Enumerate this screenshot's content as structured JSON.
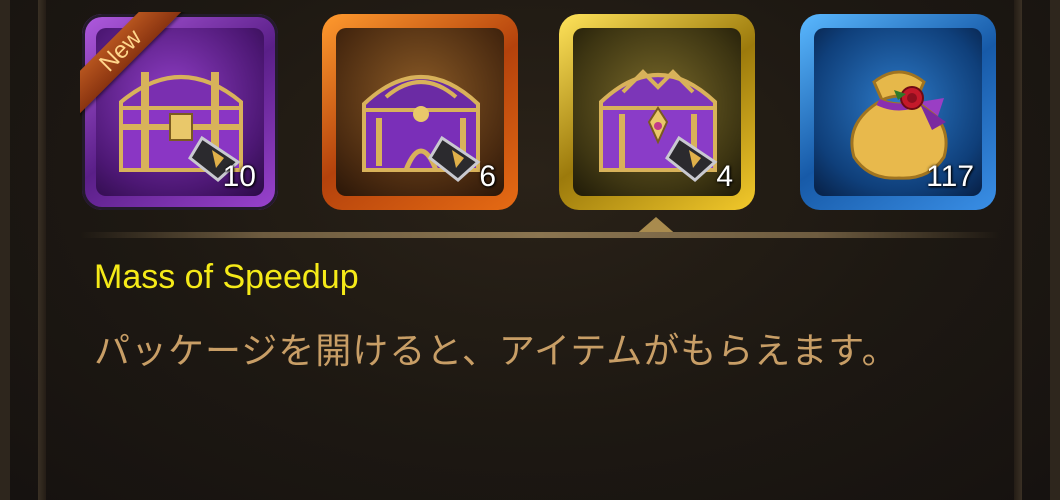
{
  "items": [
    {
      "name": "purple-chest",
      "count": "10",
      "badge": "New",
      "frame_color": "#9b46d6"
    },
    {
      "name": "orange-chest",
      "count": "6",
      "frame_color": "#e8701a"
    },
    {
      "name": "gold-chest",
      "count": "4",
      "frame_color": "#f0c82a",
      "selected": true
    },
    {
      "name": "gold-sack",
      "count": "117",
      "frame_color": "#3a8fe6"
    }
  ],
  "detail": {
    "title": "Mass of Speedup",
    "description": "パッケージを開けると、アイテムがもらえます。"
  },
  "colors": {
    "title": "#f5ea18",
    "description": "#c89e66",
    "background": "#1b1611"
  }
}
